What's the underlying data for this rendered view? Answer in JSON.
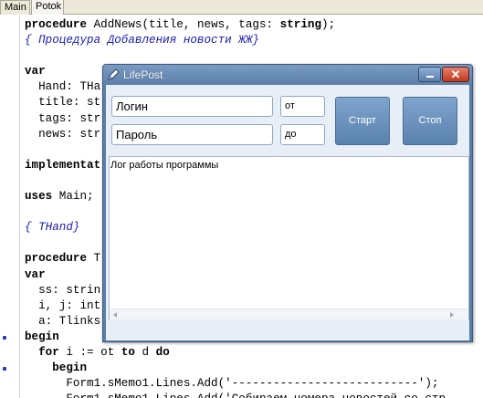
{
  "ide": {
    "tabs": [
      "Main",
      "Potok"
    ],
    "code_lines": [
      [
        {
          "t": "procedure",
          "c": "kw"
        },
        {
          "t": " AddNews(title, news, tags: ",
          "c": "st"
        },
        {
          "t": "string",
          "c": "kw"
        },
        {
          "t": ");",
          "c": "st"
        }
      ],
      [
        {
          "t": "{ Процедура Добавления новости ЖЖ}",
          "c": "cm"
        }
      ],
      [],
      [
        {
          "t": "var",
          "c": "kw"
        }
      ],
      [
        {
          "t": "  Hand: THa",
          "c": "st"
        }
      ],
      [
        {
          "t": "  title: st",
          "c": "st"
        }
      ],
      [
        {
          "t": "  tags: str",
          "c": "st"
        }
      ],
      [
        {
          "t": "  news: str",
          "c": "st"
        }
      ],
      [],
      [
        {
          "t": "implementat",
          "c": "kw"
        }
      ],
      [],
      [
        {
          "t": "uses",
          "c": "kw"
        },
        {
          "t": " Main;",
          "c": "st"
        }
      ],
      [],
      [
        {
          "t": "{ THand}",
          "c": "cm"
        }
      ],
      [],
      [
        {
          "t": "procedure",
          "c": "kw"
        },
        {
          "t": " T",
          "c": "st"
        }
      ],
      [
        {
          "t": "var",
          "c": "kw"
        }
      ],
      [
        {
          "t": "  ss: strin",
          "c": "st"
        }
      ],
      [
        {
          "t": "  i, j: int",
          "c": "st"
        }
      ],
      [
        {
          "t": "  a: Tlinks",
          "c": "st"
        }
      ],
      [
        {
          "t": "begin",
          "c": "kw"
        }
      ],
      [
        {
          "t": "  ",
          "c": "st"
        },
        {
          "t": "for",
          "c": "kw"
        },
        {
          "t": " i := ot ",
          "c": "st"
        },
        {
          "t": "to",
          "c": "kw"
        },
        {
          "t": " d ",
          "c": "st"
        },
        {
          "t": "do",
          "c": "kw"
        }
      ],
      [
        {
          "t": "    ",
          "c": "st"
        },
        {
          "t": "begin",
          "c": "kw"
        }
      ],
      [
        {
          "t": "      Form1.sMemo1.Lines.Add('---------------------------');",
          "c": "st"
        }
      ],
      [
        {
          "t": "      Form1.sMemo1.Lines.Add('Собираем номера новостей со стр",
          "c": "st"
        }
      ]
    ],
    "breakpoint_lines": [
      21,
      23,
      25,
      26
    ]
  },
  "dialog": {
    "title": "LifePost",
    "login_value": "Логин",
    "password_value": "Пароль",
    "from_value": "от",
    "to_value": "до",
    "start_label": "Старт",
    "stop_label": "Стоп",
    "log_text": "Лог работы программы",
    "close_glyph": "✕"
  }
}
